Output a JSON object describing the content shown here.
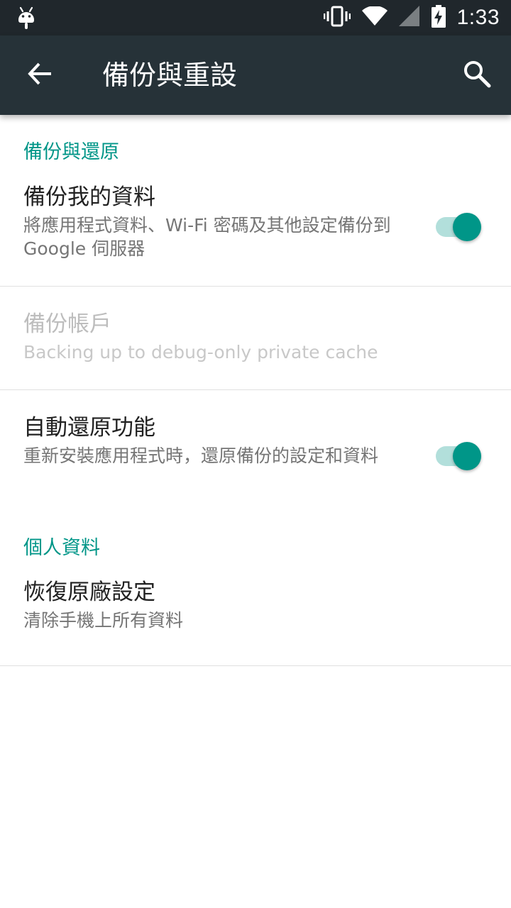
{
  "status_bar": {
    "time": "1:33",
    "icons": [
      "android-icon",
      "vibrate-icon",
      "wifi-icon",
      "cell-signal-icon",
      "battery-charging-icon"
    ]
  },
  "app_bar": {
    "title": "備份與重設",
    "back_icon": "arrow-back-icon",
    "search_icon": "search-icon",
    "color": "#263238"
  },
  "sections": [
    {
      "header": "備份與還原",
      "items": [
        {
          "title": "備份我的資料",
          "summary": "將應用程式資料、Wi-Fi 密碼及其他設定備份到 Google 伺服器",
          "switch": true,
          "enabled": true
        },
        {
          "title": "備份帳戶",
          "summary": "Backing up to debug-only private cache",
          "enabled": false
        },
        {
          "title": "自動還原功能",
          "summary": "重新安裝應用程式時，還原備份的設定和資料",
          "switch": true,
          "enabled": true
        }
      ]
    },
    {
      "header": "個人資料",
      "items": [
        {
          "title": "恢復原廠設定",
          "summary": "清除手機上所有資料",
          "enabled": true
        }
      ]
    }
  ],
  "colors": {
    "accent": "#009688",
    "switch_track": "#b2dfdb",
    "status_bar": "#20272c"
  }
}
